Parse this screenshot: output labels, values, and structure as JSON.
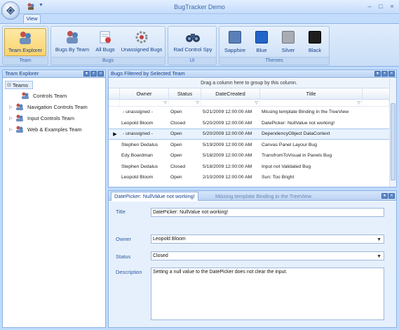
{
  "window": {
    "title": "BugTracker Demo",
    "min": "–",
    "max": "□",
    "close": "×"
  },
  "ribbon_tabs": [
    {
      "label": "View"
    }
  ],
  "ribbon_groups": {
    "team": {
      "label": "Team",
      "buttons": [
        {
          "label": "Team Explorer"
        }
      ]
    },
    "bugs": {
      "label": "Bugs",
      "buttons": [
        {
          "label": "Bugs By Team"
        },
        {
          "label": "All Bugs"
        },
        {
          "label": "Unassigned Bugs"
        }
      ]
    },
    "ui": {
      "label": "UI",
      "buttons": [
        {
          "label": "Rad Control Spy"
        }
      ]
    },
    "themes": {
      "label": "Themes",
      "buttons": [
        {
          "label": "Sapphire",
          "color": "#5b7fb8"
        },
        {
          "label": "Blue",
          "color": "#2264c8"
        },
        {
          "label": "Silver",
          "color": "#a8acb3"
        },
        {
          "label": "Black",
          "color": "#1e1e1e"
        }
      ]
    }
  },
  "team_explorer": {
    "title": "Team Explorer",
    "root": "Teams",
    "items": [
      {
        "label": "Controls Team"
      },
      {
        "label": "Navigation Controls Team"
      },
      {
        "label": "Input Controls Team"
      },
      {
        "label": "Web & Examples Team"
      }
    ]
  },
  "bugs_panel": {
    "title": "Bugs Filtered by Selected Team",
    "group_hint": "Drag a column here to group by this column.",
    "columns": [
      "Owner",
      "Status",
      "DateCreated",
      "Title"
    ],
    "rows": [
      {
        "owner": "- unassigned -",
        "status": "Open",
        "date": "5/21/2009 12:00:00 AM",
        "title": "Missing template Binding in the TreeView"
      },
      {
        "owner": "Leopold Bloom",
        "status": "Closed",
        "date": "5/20/2009 12:00:00 AM",
        "title": "DatePicker: NullValue not working!"
      },
      {
        "owner": "- unassigned -",
        "status": "Open",
        "date": "5/20/2009 12:00:00 AM",
        "title": "DependencyObject DataContext"
      },
      {
        "owner": "Stephen Dedalus",
        "status": "Open",
        "date": "5/19/2009 12:00:00 AM",
        "title": "Canvas Panel Layour Bug"
      },
      {
        "owner": "Edy Boardman",
        "status": "Open",
        "date": "5/18/2009 12:00:00 AM",
        "title": "TransfromToVisual in Panels Bug"
      },
      {
        "owner": "Stephen Dedalus",
        "status": "Closed",
        "date": "5/18/2009 12:00:00 AM",
        "title": "Input not Validated Bug"
      },
      {
        "owner": "Leopold Bloom",
        "status": "Open",
        "date": "2/10/2009 12:00:00 AM",
        "title": "Sun: Too Bright"
      }
    ],
    "selected_row": 2
  },
  "detail_panel": {
    "tabs": [
      {
        "label": "DatePicker: NullValue not working!"
      },
      {
        "label": "Missing template Binding in the TreeView"
      }
    ],
    "fields": {
      "title_label": "Title",
      "title_value": "DatePicker: NullValue not working!",
      "owner_label": "Owner",
      "owner_value": "Leopold Bloom",
      "status_label": "Status",
      "status_value": "Closed",
      "description_label": "Description",
      "description_value": "Setting a null value to the DatePicker does not clear the input."
    }
  }
}
